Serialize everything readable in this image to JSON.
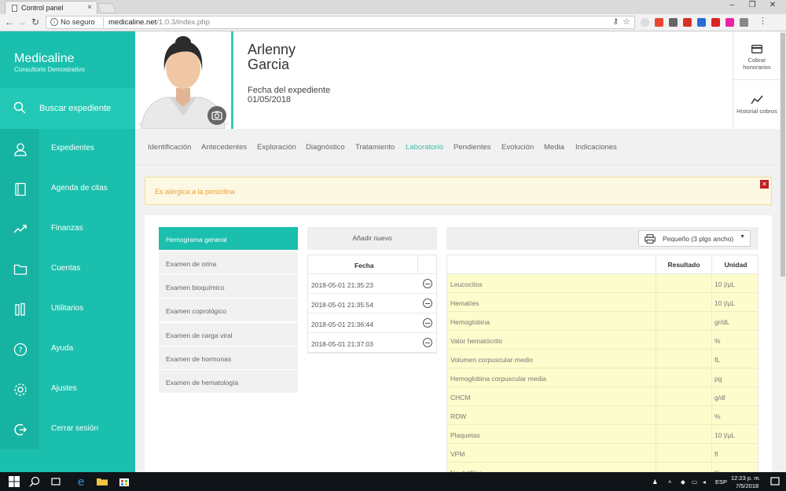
{
  "browser": {
    "tab_title": "Control panel",
    "security_label": "No seguro",
    "url_host": "medicaline.net",
    "url_path": "/1.0.3/index.php"
  },
  "sidebar": {
    "brand": "Medicaline",
    "subtitle": "Consultorio Demostrativo",
    "search_label": "Buscar expediente",
    "items": [
      {
        "label": "Expedientes",
        "icon": "user-icon"
      },
      {
        "label": "Agenda de citas",
        "icon": "book-icon"
      },
      {
        "label": "Finanzas",
        "icon": "trend-icon"
      },
      {
        "label": "Cuentas",
        "icon": "folder-icon"
      },
      {
        "label": "Utilitarios",
        "icon": "tools-icon"
      },
      {
        "label": "Ayuda",
        "icon": "help-icon"
      },
      {
        "label": "Ajustes",
        "icon": "gear-icon"
      },
      {
        "label": "Cerrar sesión",
        "icon": "logout-icon"
      }
    ]
  },
  "patient": {
    "first_name": "Arlenny",
    "last_name": "Garcia",
    "record_label": "Fecha del expediente",
    "record_date": "01/05/2018"
  },
  "actions": {
    "fees": "Cobrar honorarios",
    "history": "Historial cobros"
  },
  "tabs": [
    "Identificación",
    "Antecedentes",
    "Exploración",
    "Diagnóstico",
    "Tratamiento",
    "Laboratorio",
    "Pendientes",
    "Evolución",
    "Media",
    "Indicaciones"
  ],
  "active_tab": "Laboratorio",
  "alert": {
    "text": "Es alérgica a la penicilina"
  },
  "exams": [
    "Hemograma general",
    "Examen de orina",
    "Examen bioquímico",
    "Examen coprológico",
    "Examen de carga viral",
    "Examen de hormonas",
    "Examen de hematología"
  ],
  "add_button": "Añadir nuevo",
  "dates": {
    "header": "Fecha",
    "rows": [
      "2018-05-01 21:35:23",
      "2018-05-01 21:35:54",
      "2018-05-01 21:36:44",
      "2018-05-01 21:37:03"
    ]
  },
  "print_size": {
    "value": "Pequeño (3 plgs ancho)"
  },
  "results": {
    "headers": {
      "result": "Resultado",
      "unit": "Unidad"
    },
    "rows": [
      {
        "name": "Leucocitos",
        "unit": "10 |/µL"
      },
      {
        "name": "Hematíes",
        "unit": "10 |/µL"
      },
      {
        "name": "Hemoglobina",
        "unit": "gr/dL"
      },
      {
        "name": "Valor hematócrito",
        "unit": "%"
      },
      {
        "name": "Volumen corpuscular medio",
        "unit": "fL"
      },
      {
        "name": "Hemoglobina corpuscular media",
        "unit": "pg"
      },
      {
        "name": "CHCM",
        "unit": "g/dl"
      },
      {
        "name": "RDW",
        "unit": "%"
      },
      {
        "name": "Plaquetas",
        "unit": "10 |/µL"
      },
      {
        "name": "VPM",
        "unit": "fl"
      },
      {
        "name": "Neutrófilos",
        "unit": "%"
      }
    ]
  },
  "taskbar": {
    "lang": "ESP",
    "time": "12:23 p. m.",
    "date": "7/5/2018"
  },
  "colors": {
    "accent": "#1bbfad",
    "alert_text": "#f0a030",
    "result_bg": "#fcfccc"
  }
}
